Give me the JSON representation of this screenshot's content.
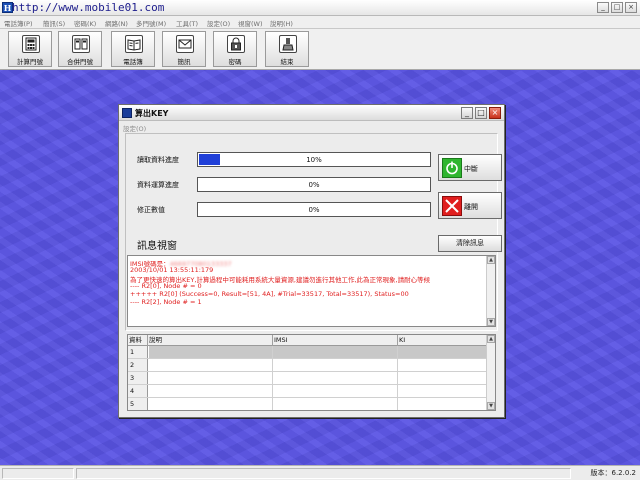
{
  "app": {
    "title": "http://www.mobile01.com",
    "title_icon": "H",
    "window_buttons": [
      "_",
      "□",
      "×"
    ]
  },
  "menu": {
    "items": [
      "電話簿(P)",
      "簡訊(S)",
      "密碼(K)",
      "網路(N)",
      "多門號(M)",
      "工具(T)",
      "設定(O)",
      "視窗(W)",
      "說明(H)"
    ]
  },
  "toolbar": {
    "buttons": [
      {
        "label": "計算門號",
        "icon": "calculator-icon"
      },
      {
        "label": "合併門號",
        "icon": "merge-icon"
      },
      {
        "label": "電話簿",
        "icon": "phonebook-icon"
      },
      {
        "label": "簡訊",
        "icon": "envelope-icon"
      },
      {
        "label": "密碼",
        "icon": "lock-icon"
      },
      {
        "label": "結束",
        "icon": "exit-icon"
      }
    ]
  },
  "status": {
    "version": "版本：6.2.0.2"
  },
  "dialog": {
    "title": "算出KEY",
    "menu": "設定(O)",
    "buttons": [
      "_",
      "□",
      "×"
    ],
    "progress": [
      {
        "label": "讀取資料進度",
        "percent": 10,
        "text": "10%"
      },
      {
        "label": "資料運算進度",
        "percent": 0,
        "text": "0%"
      },
      {
        "label": "修正數值",
        "percent": 0,
        "text": "0%"
      }
    ],
    "stop_button": "中斷",
    "exit_button": "離開",
    "log_section_label": "訊息視窗",
    "clear_button": "清除訊息",
    "log": {
      "imsi_label": "IMSI號碼是：",
      "imsi_value": "466977080133337",
      "lines": [
        "2003/10/01 13:55:11:179",
        "為了更快速的算出KEY,計算過程中可能耗用系統大量資源,建議勿進行其他工作,此為正常現象,請耐心等候",
        "---- R2[0], Node # = 0",
        "+++++ R2[0] (Success=0, Result=[51, 4A], #Trial=33517, Total=33517), Status=00",
        "---- R2[2], Node # = 1"
      ],
      "scroll_up": "▲",
      "scroll_down": "▼"
    },
    "grid": {
      "columns": [
        "資料",
        "說明",
        "IMSI",
        "KI"
      ],
      "rows": [
        "1",
        "2",
        "3",
        "4",
        "5"
      ],
      "scroll_up": "▲",
      "scroll_down": "▼"
    }
  }
}
